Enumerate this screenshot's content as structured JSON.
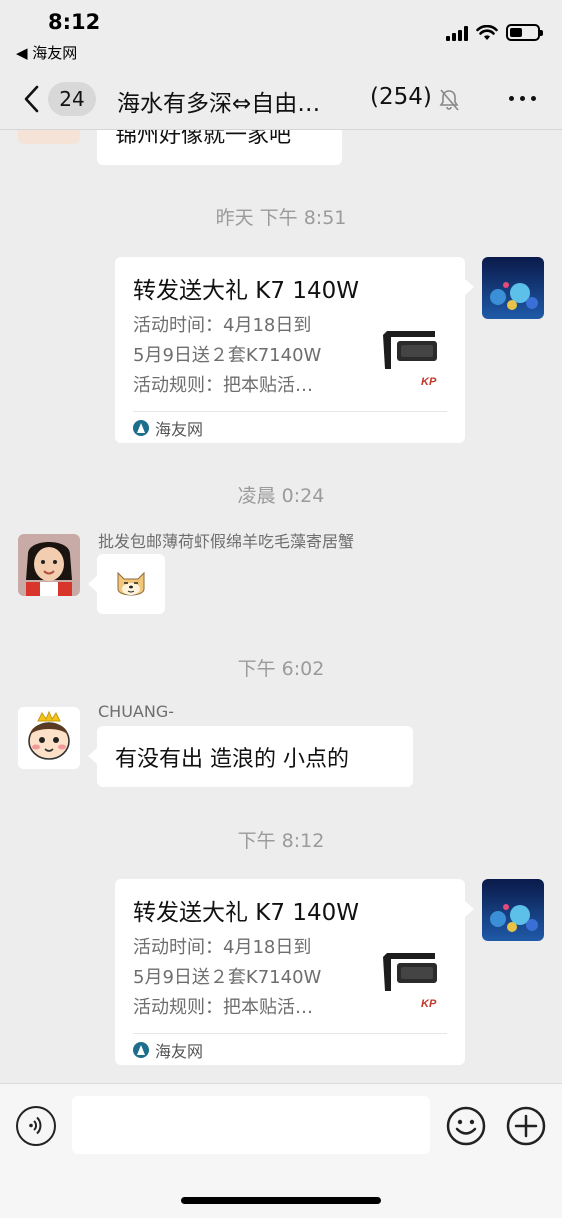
{
  "status_bar": {
    "time": "8:12",
    "back_app": "◀ 海友网"
  },
  "nav": {
    "unread_count": "24",
    "title": "海水有多深⇔自由…",
    "member_count": "(254)"
  },
  "messages": {
    "partial_top": {
      "text": "锦州好像就一家吧"
    },
    "time1": "昨天 下午 8:51",
    "card1": {
      "title": "转发送大礼 K7 140W",
      "desc_line1": "活动时间：4月18日到",
      "desc_line2": "5月9日送２套K7140W",
      "desc_line3": "活动规则：把本贴活…",
      "source": "海友网"
    },
    "time2": "凌晨 0:24",
    "msg_girl": {
      "sender": "批发包邮薄荷虾假绵羊吃毛藻寄居蟹",
      "sticker": "doge-sticker"
    },
    "time3": "下午 6:02",
    "msg_chuang": {
      "sender": "CHUANG-",
      "text": "有没有出 造浪的  小点的"
    },
    "time4": "下午 8:12",
    "card2": {
      "title": "转发送大礼 K7 140W",
      "desc_line1": "活动时间：4月18日到",
      "desc_line2": "5月9日送２套K7140W",
      "desc_line3": "活动规则：把本贴活…",
      "source": "海友网"
    }
  },
  "input_bar": {
    "placeholder": ""
  },
  "colors": {
    "background": "#ededed",
    "bubble": "#ffffff",
    "time_label": "#9b9b9b"
  }
}
